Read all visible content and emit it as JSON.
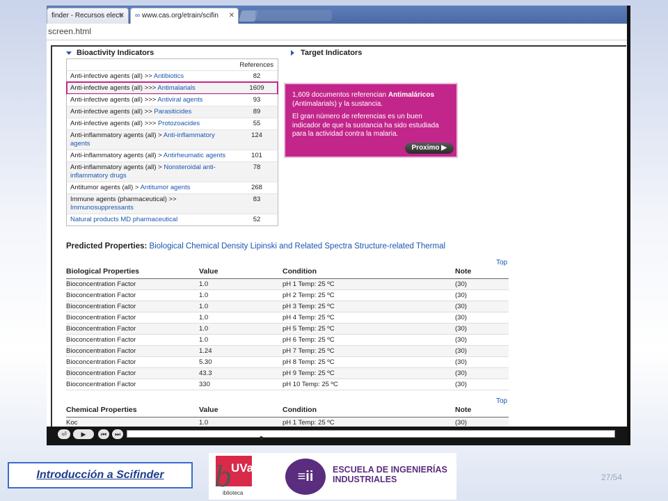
{
  "browser": {
    "tabs": [
      {
        "label": "finder - Recursos electr",
        "close": "✕"
      },
      {
        "label": "www.cas.org/etrain/scifin",
        "close": "✕"
      }
    ],
    "address": "screen.html"
  },
  "bioactivity": {
    "heading": "Bioactivity Indicators",
    "references_header": "References",
    "rows": [
      {
        "prefix": "Anti-infective agents (all) >> ",
        "link": "Antibiotics",
        "ref": "82"
      },
      {
        "prefix": "Anti-infective agents (all) >>> ",
        "link": "Antimalarials",
        "ref": "1609"
      },
      {
        "prefix": "Anti-infective agents (all) >>> ",
        "link": "Antiviral agents",
        "ref": "93"
      },
      {
        "prefix": "Anti-infective agents (all) >> ",
        "link": "Parasiticides",
        "ref": "89"
      },
      {
        "prefix": "Anti-infective agents (all) >>> ",
        "link": "Protozoacides",
        "ref": "55"
      },
      {
        "prefix": "Anti-inflammatory agents (all) > ",
        "link": "Anti-inflammatory agents",
        "ref": "124"
      },
      {
        "prefix": "Anti-inflammatory agents (all) > ",
        "link": "Antirheumatic agents",
        "ref": "101"
      },
      {
        "prefix": "Anti-inflammatory agents (all) > ",
        "link": "Nonsteroidal anti-inflammatory drugs",
        "ref": "78"
      },
      {
        "prefix": "Antitumor agents (all) > ",
        "link": "Antitumor agents",
        "ref": "268"
      },
      {
        "prefix": "Immune agents (pharmaceutical) >> ",
        "link": "Immunosuppressants",
        "ref": "83"
      },
      {
        "prefix": "",
        "link": "Natural products MD pharmaceutical",
        "ref": "52"
      }
    ]
  },
  "target": {
    "heading": "Target Indicators"
  },
  "callout": {
    "line1_pre": "1,609 documentos referencian ",
    "line1_bold": "Antimaláricos",
    "line1_post": " (Antimalarials) y la sustancia.",
    "line2": "El gran número de referencias es un buen indicador de que la sustancia ha sido estudiada para la actividad contra la malaria.",
    "button": "Proximo ▶"
  },
  "predicted": {
    "label": "Predicted Properties:",
    "links": "Biological Chemical Density Lipinski and Related Spectra Structure-related Thermal"
  },
  "bio_props": {
    "top": "Top",
    "headers": [
      "Biological Properties",
      "Value",
      "Condition",
      "Note"
    ],
    "rows": [
      [
        "Bioconcentration Factor",
        "1.0",
        "pH 1 Temp: 25 ºC",
        "(30)"
      ],
      [
        "Bioconcentration Factor",
        "1.0",
        "pH 2 Temp: 25 ºC",
        "(30)"
      ],
      [
        "Bioconcentration Factor",
        "1.0",
        "pH 3 Temp: 25 ºC",
        "(30)"
      ],
      [
        "Bioconcentration Factor",
        "1.0",
        "pH 4 Temp: 25 ºC",
        "(30)"
      ],
      [
        "Bioconcentration Factor",
        "1.0",
        "pH 5 Temp: 25 ºC",
        "(30)"
      ],
      [
        "Bioconcentration Factor",
        "1.0",
        "pH 6 Temp: 25 ºC",
        "(30)"
      ],
      [
        "Bioconcentration Factor",
        "1.24",
        "pH 7 Temp: 25 ºC",
        "(30)"
      ],
      [
        "Bioconcentration Factor",
        "5.30",
        "pH 8 Temp: 25 ºC",
        "(30)"
      ],
      [
        "Bioconcentration Factor",
        "43.3",
        "pH 9 Temp: 25 ºC",
        "(30)"
      ],
      [
        "Bioconcentration Factor",
        "330",
        "pH 10 Temp: 25 ºC",
        "(30)"
      ]
    ]
  },
  "chem_props": {
    "top": "Top",
    "headers": [
      "Chemical Properties",
      "Value",
      "Condition",
      "Note"
    ],
    "rows": [
      [
        "Koc",
        "1.0",
        "pH 1 Temp: 25 ºC",
        "(30)"
      ]
    ]
  },
  "player": {
    "buttons": [
      "⏎",
      "▶",
      "⏮",
      "⏭"
    ]
  },
  "footer": {
    "title": "Introducción a Scifinder",
    "page": "27/54",
    "uva": "UVa",
    "uva_sub": "iblioteca",
    "eii_text_1": "ESCUELA DE INGENIERÍAS",
    "eii_text_2": "INDUSTRIALES"
  }
}
